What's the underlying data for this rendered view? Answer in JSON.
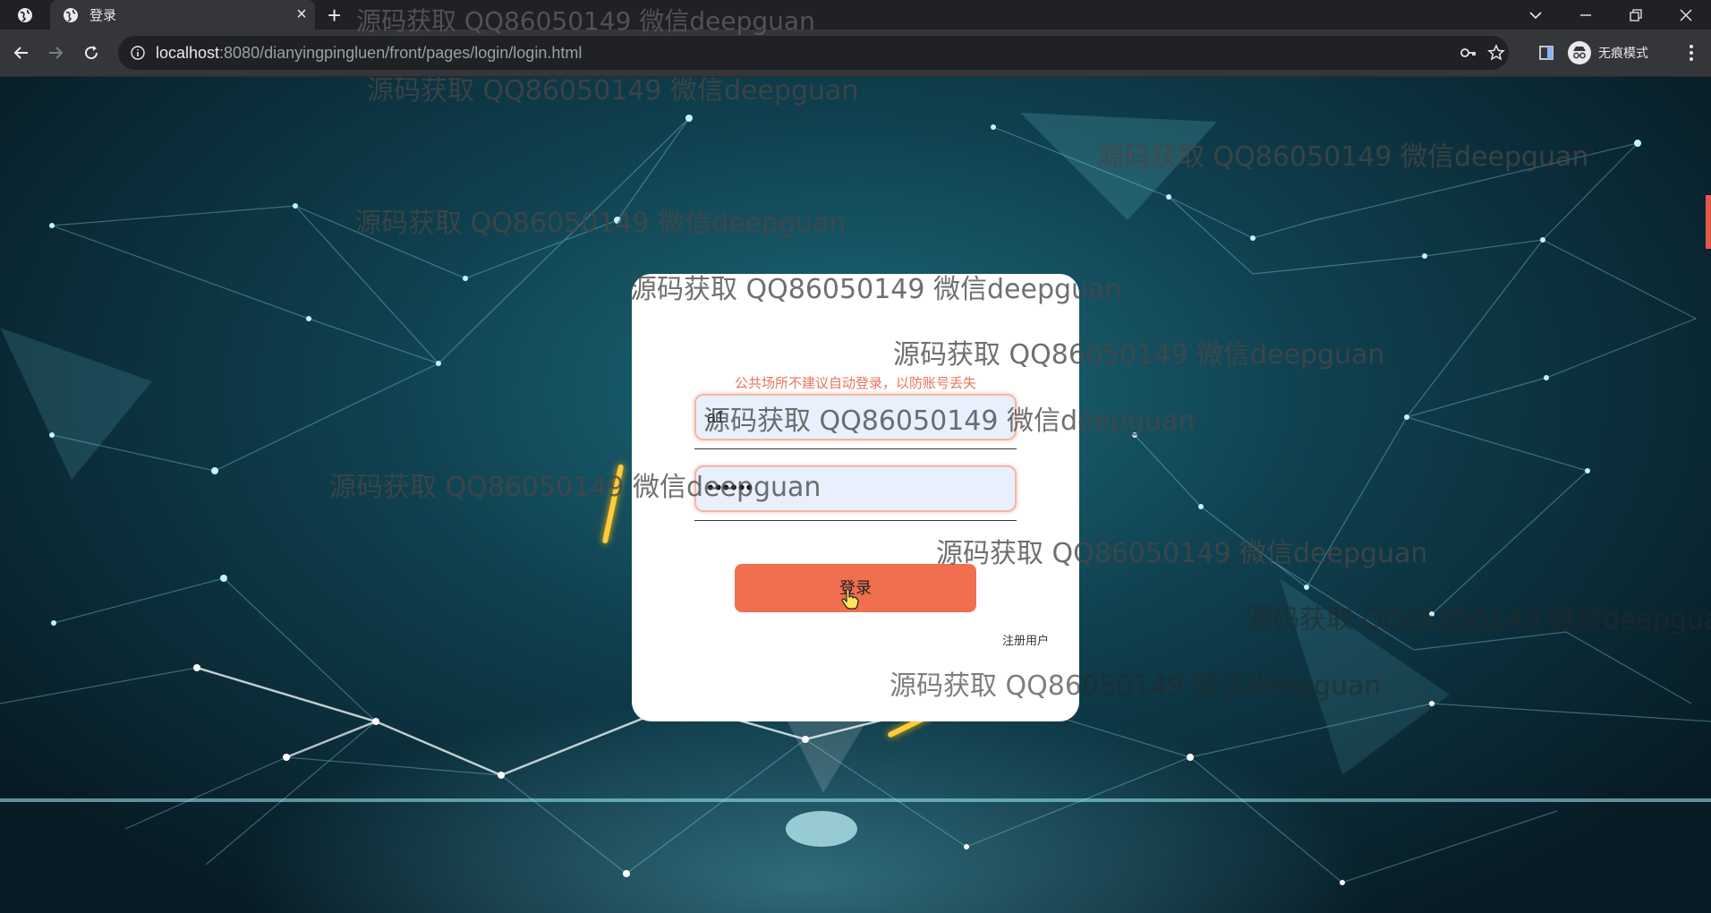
{
  "browser": {
    "tab": {
      "title": "登录",
      "close": "×"
    },
    "new_tab": "+",
    "url_host": "localhost",
    "url_rest": ":8080/dianyingpingluen/front/pages/login/login.html",
    "incognito_label": "无痕模式"
  },
  "login": {
    "notice": "公共场所不建议自动登录，以防账号丢失",
    "username_value": "a1",
    "password_mask": "••••••",
    "login_button": "登录",
    "register_link": "注册用户"
  },
  "watermark": {
    "text": "源码获取 QQ86050149 微信deepguan"
  },
  "colors": {
    "accent": "#ef6f4e",
    "notice": "#e8755a",
    "input_bg": "#e8f0fe"
  }
}
